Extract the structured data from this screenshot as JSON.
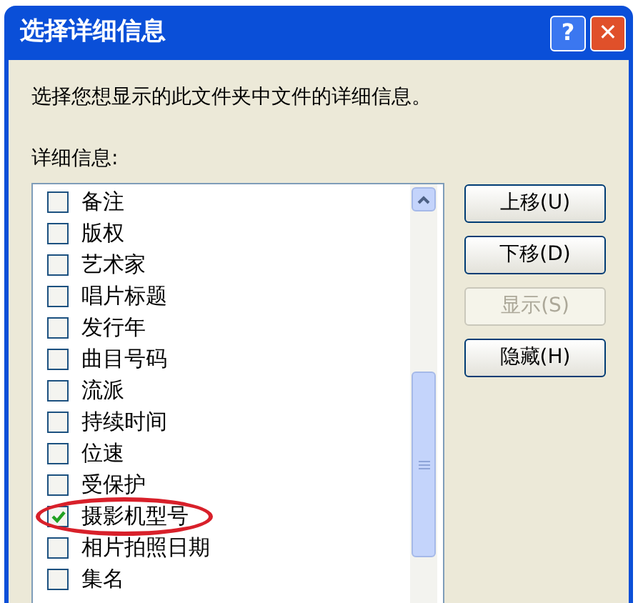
{
  "window": {
    "title": "选择详细信息",
    "buttons": [
      {
        "kind": "help",
        "label": "?"
      },
      {
        "kind": "close",
        "label": "✕"
      }
    ]
  },
  "description": "选择您想显示的此文件夹中文件的详细信息。",
  "list_label": "详细信息:",
  "details": [
    {
      "label": "备注",
      "checked": false,
      "highlighted": false
    },
    {
      "label": "版权",
      "checked": false,
      "highlighted": false
    },
    {
      "label": "艺术家",
      "checked": false,
      "highlighted": false
    },
    {
      "label": "唱片标题",
      "checked": false,
      "highlighted": false
    },
    {
      "label": "发行年",
      "checked": false,
      "highlighted": false
    },
    {
      "label": "曲目号码",
      "checked": false,
      "highlighted": false
    },
    {
      "label": "流派",
      "checked": false,
      "highlighted": false
    },
    {
      "label": "持续时间",
      "checked": false,
      "highlighted": false
    },
    {
      "label": "位速",
      "checked": false,
      "highlighted": false
    },
    {
      "label": "受保护",
      "checked": false,
      "highlighted": false
    },
    {
      "label": "摄影机型号",
      "checked": true,
      "highlighted": true
    },
    {
      "label": "相片拍照日期",
      "checked": false,
      "highlighted": false
    },
    {
      "label": "集名",
      "checked": false,
      "highlighted": false
    }
  ],
  "buttons": [
    {
      "label": "上移(U)",
      "disabled": false
    },
    {
      "label": "下移(D)",
      "disabled": false
    },
    {
      "label": "显示(S)",
      "disabled": true
    },
    {
      "label": "隐藏(H)",
      "disabled": false
    }
  ]
}
